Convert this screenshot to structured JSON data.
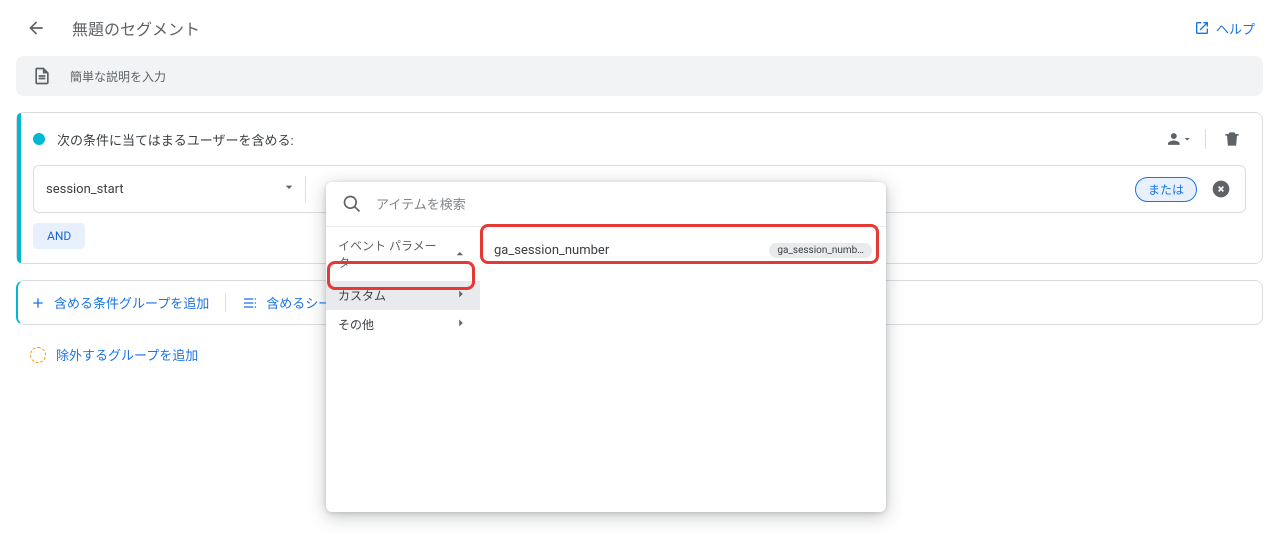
{
  "header": {
    "title": "無題のセグメント",
    "help_label": "ヘルプ"
  },
  "description": {
    "placeholder": "簡単な説明を入力"
  },
  "include_group": {
    "title": "次の条件に当てはまるユーザーを含める:",
    "event_label": "session_start",
    "or_label": "または",
    "and_label": "AND"
  },
  "add_bar": {
    "add_group_label": "含める条件グループを追加",
    "add_sequence_label": "含めるシーケンスを追加"
  },
  "exclude": {
    "label": "除外するグループを追加"
  },
  "popover": {
    "search_placeholder": "アイテムを検索",
    "section_header": "イベント パラメータ",
    "categories": [
      {
        "label": "カスタム",
        "active": true
      },
      {
        "label": "その他",
        "active": false
      }
    ],
    "results": [
      {
        "label": "ga_session_number",
        "badge": "ga_session_numb…"
      }
    ]
  }
}
